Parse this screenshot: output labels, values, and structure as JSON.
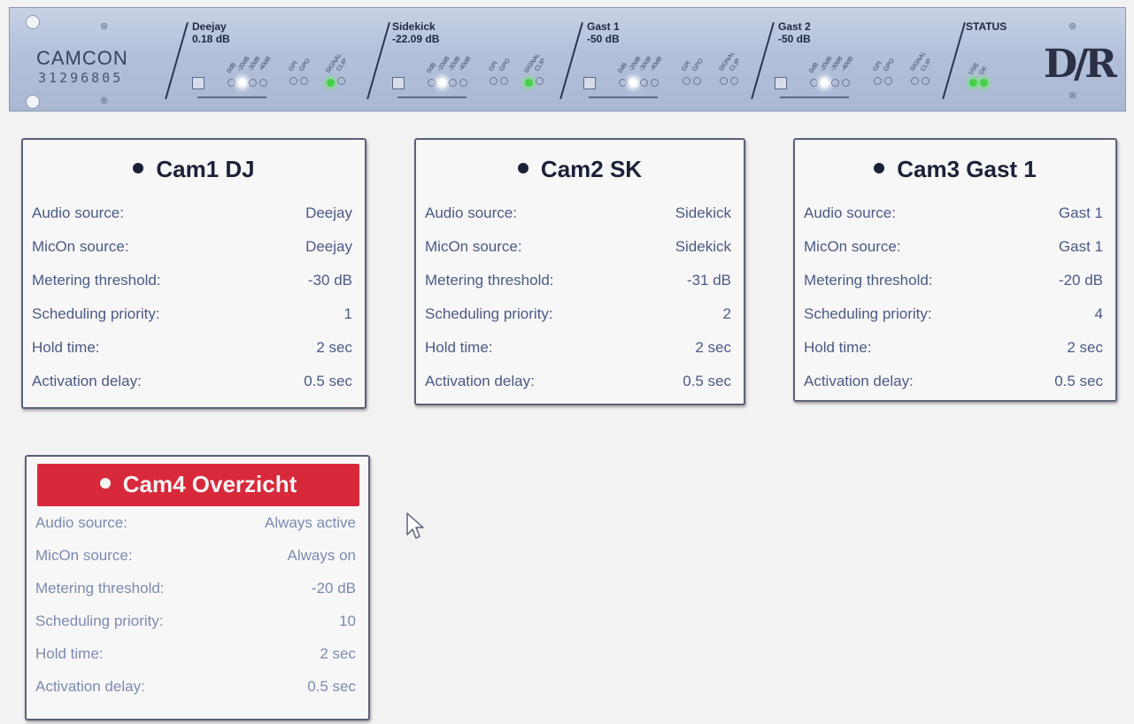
{
  "device": {
    "brand": "CAMCON",
    "serial": "31296805",
    "logo": "D∕R",
    "channels": [
      {
        "name": "Deejay",
        "level": "0.18 dB",
        "signal_green": true
      },
      {
        "name": "Sidekick",
        "level": "-22.09 dB",
        "signal_green": true
      },
      {
        "name": "Gast 1",
        "level": "-50 dB",
        "signal_green": false
      },
      {
        "name": "Gast 2",
        "level": "-50 dB",
        "signal_green": false
      }
    ],
    "meter_labels": [
      "0dB",
      "-20dB",
      "-30dB",
      "-40dB"
    ],
    "gpio_labels": [
      "GPI",
      "GPO"
    ],
    "signal_labels": [
      "SIGNAL",
      "CLIP"
    ],
    "status": {
      "title": "STATUS",
      "labels": [
        "USB",
        "OK"
      ]
    }
  },
  "cameras": [
    {
      "title": "Cam1 DJ",
      "active": false,
      "rows": [
        {
          "label": "Audio source:",
          "value": "Deejay"
        },
        {
          "label": "MicOn source:",
          "value": "Deejay"
        },
        {
          "label": "Metering threshold:",
          "value": "-30 dB"
        },
        {
          "label": "Scheduling priority:",
          "value": "1"
        },
        {
          "label": "Hold time:",
          "value": "2 sec"
        },
        {
          "label": "Activation delay:",
          "value": "0.5 sec"
        }
      ]
    },
    {
      "title": "Cam2 SK",
      "active": false,
      "rows": [
        {
          "label": "Audio source:",
          "value": "Sidekick"
        },
        {
          "label": "MicOn source:",
          "value": "Sidekick"
        },
        {
          "label": "Metering threshold:",
          "value": "-31 dB"
        },
        {
          "label": "Scheduling priority:",
          "value": "2"
        },
        {
          "label": "Hold time:",
          "value": "2 sec"
        },
        {
          "label": "Activation delay:",
          "value": "0.5 sec"
        }
      ]
    },
    {
      "title": "Cam3 Gast 1",
      "active": false,
      "rows": [
        {
          "label": "Audio source:",
          "value": "Gast 1"
        },
        {
          "label": "MicOn source:",
          "value": "Gast 1"
        },
        {
          "label": "Metering threshold:",
          "value": "-20 dB"
        },
        {
          "label": "Scheduling priority:",
          "value": "4"
        },
        {
          "label": "Hold time:",
          "value": "2 sec"
        },
        {
          "label": "Activation delay:",
          "value": "0.5 sec"
        }
      ]
    },
    {
      "title": "Cam4 Overzicht",
      "active": true,
      "rows": [
        {
          "label": "Audio source:",
          "value": "Always active"
        },
        {
          "label": "MicOn source:",
          "value": "Always on"
        },
        {
          "label": "Metering threshold:",
          "value": "-20 dB"
        },
        {
          "label": "Scheduling priority:",
          "value": "10"
        },
        {
          "label": "Hold time:",
          "value": "2 sec"
        },
        {
          "label": "Activation delay:",
          "value": "0.5 sec"
        }
      ]
    }
  ],
  "colors": {
    "active_header": "#d8293a",
    "card_border": "#5a6178",
    "label_text": "#4a5a84",
    "panel_bg": "#b3c0da",
    "led_green": "#47d04a"
  }
}
